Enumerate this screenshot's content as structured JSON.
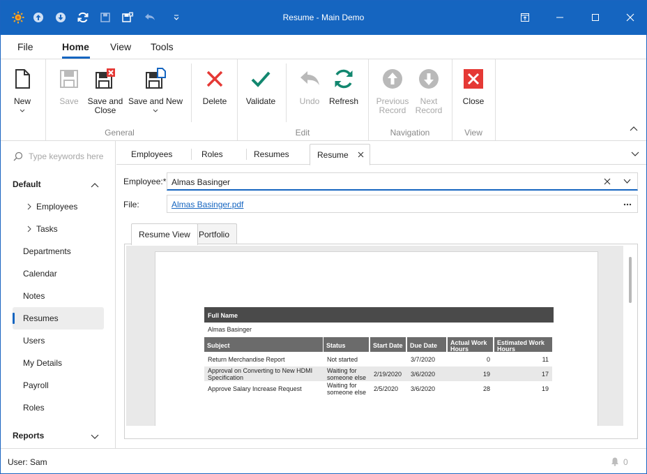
{
  "window": {
    "title": "Resume - Main Demo"
  },
  "menu": {
    "tabs": [
      "File",
      "Home",
      "View",
      "Tools"
    ],
    "active": "Home"
  },
  "ribbon": {
    "new": "New",
    "save": "Save",
    "save_close": [
      "Save and",
      "Close"
    ],
    "save_new": "Save and New",
    "delete": "Delete",
    "validate": "Validate",
    "undo": "Undo",
    "refresh": "Refresh",
    "previous": [
      "Previous",
      "Record"
    ],
    "next": [
      "Next",
      "Record"
    ],
    "close": "Close",
    "groups": {
      "general": "General",
      "edit": "Edit",
      "navigation": "Navigation",
      "view": "View"
    }
  },
  "sidebar": {
    "search_placeholder": "Type keywords here",
    "default_header": "Default",
    "reports_header": "Reports",
    "items": [
      "Employees",
      "Tasks",
      "Departments",
      "Calendar",
      "Notes",
      "Resumes",
      "Users",
      "My Details",
      "Payroll",
      "Roles"
    ],
    "selected": "Resumes"
  },
  "doc_tabs": [
    "Employees",
    "Roles",
    "Resumes",
    "Resume"
  ],
  "form": {
    "employee_label": "Employee:",
    "required_mark": "*",
    "employee_value": "Almas Basinger",
    "file_label": "File:",
    "file_value": "Almas Basinger.pdf"
  },
  "inner_tabs": [
    "Resume View",
    "Portfolio"
  ],
  "report": {
    "full_name_header": "Full Name",
    "full_name": "Almas Basinger",
    "columns": [
      "Subject",
      "Status",
      "Start Date",
      "Due Date",
      "Actual Work Hours",
      "Estimated Work Hours"
    ],
    "rows": [
      [
        "Return Merchandise Report",
        "Not started",
        "",
        "3/7/2020",
        "0",
        "11"
      ],
      [
        "Approval on Converting to New HDMI Specification",
        "Waiting for someone else",
        "2/19/2020",
        "3/6/2020",
        "19",
        "17"
      ],
      [
        "Approve Salary Increase Request",
        "Waiting for someone else",
        "2/5/2020",
        "3/6/2020",
        "28",
        "19"
      ]
    ]
  },
  "status": {
    "user": "User: Sam",
    "notifications": "0"
  },
  "colors": {
    "accent": "#1565c0",
    "delete_red": "#e53935",
    "validate_green": "#12876f"
  }
}
